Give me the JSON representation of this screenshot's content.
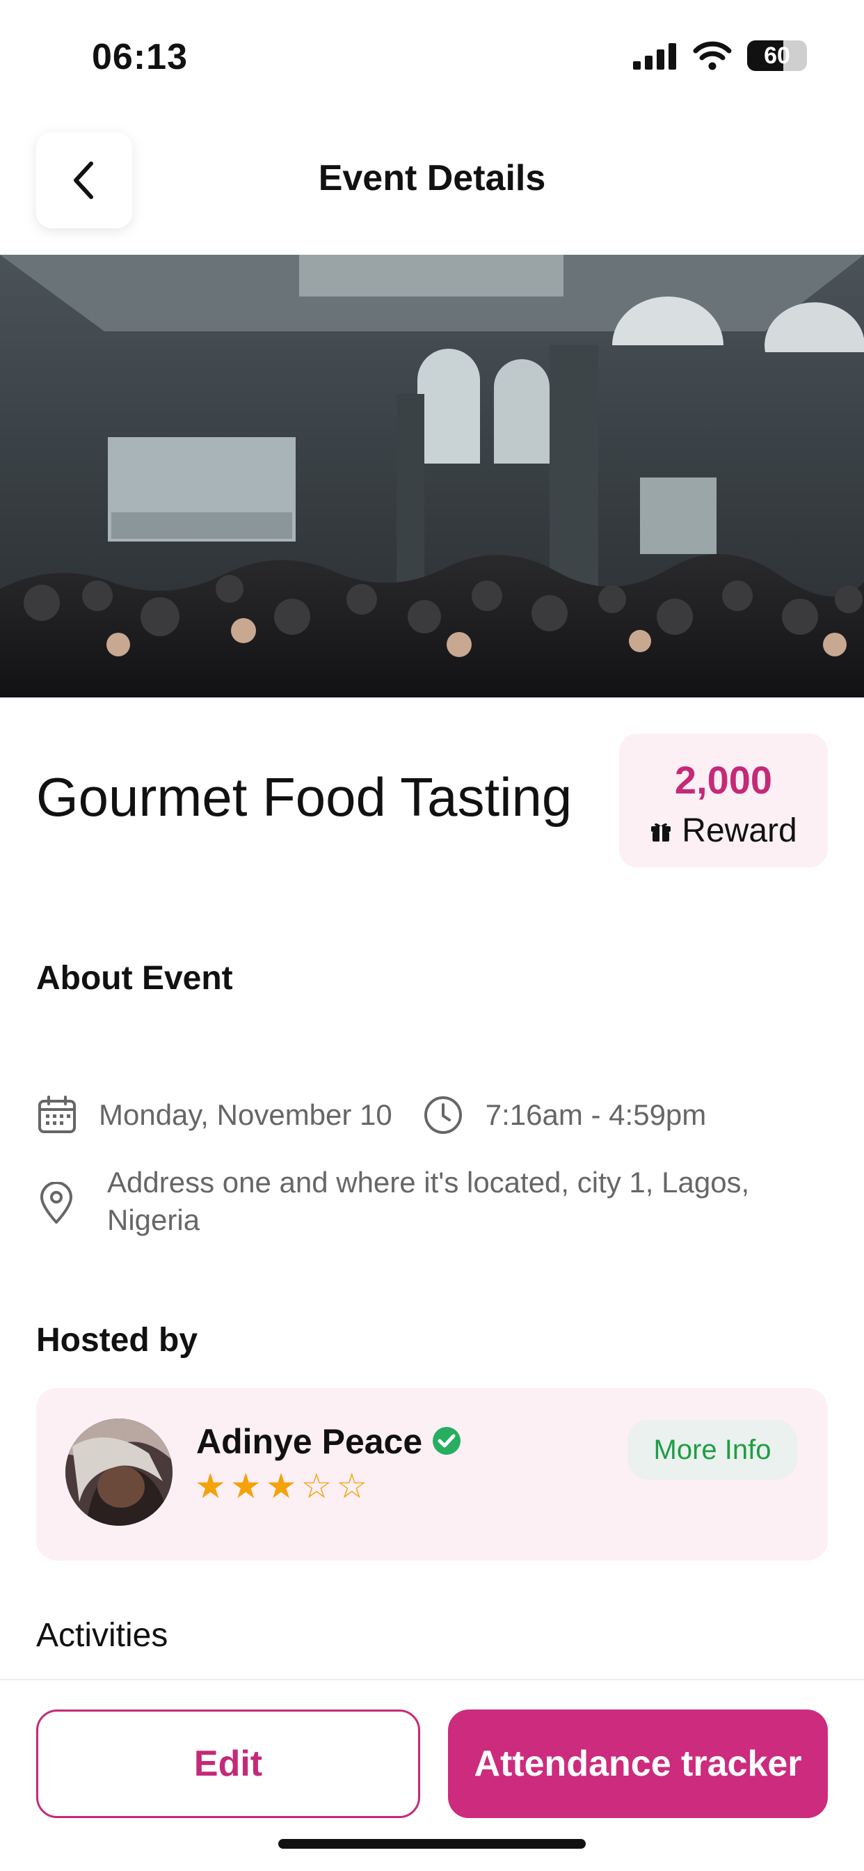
{
  "status_bar": {
    "time": "06:13",
    "battery_level": "60",
    "battery_fraction": 0.6
  },
  "header": {
    "title": "Event Details"
  },
  "event": {
    "title": "Gourmet Food Tasting",
    "reward": {
      "amount": "2,000",
      "label": "Reward"
    },
    "about_heading": "About Event",
    "date": "Monday, November 10",
    "time": "7:16am - 4:59pm",
    "address": "Address one and where it's located, city 1, Lagos, Nigeria"
  },
  "host": {
    "heading": "Hosted by",
    "name": "Adinye Peace",
    "rating": 3,
    "rating_max": 5,
    "more_info_label": "More Info"
  },
  "activities_heading": "Activities",
  "actions": {
    "edit_label": "Edit",
    "attendance_label": "Attendance tracker"
  },
  "colors": {
    "accent": "#cc2b7e",
    "reward_text": "#c42a78",
    "card_bg": "#fcf0f5",
    "star": "#f4a20a",
    "verified": "#27ae60",
    "more_info_text": "#1f9d45"
  }
}
